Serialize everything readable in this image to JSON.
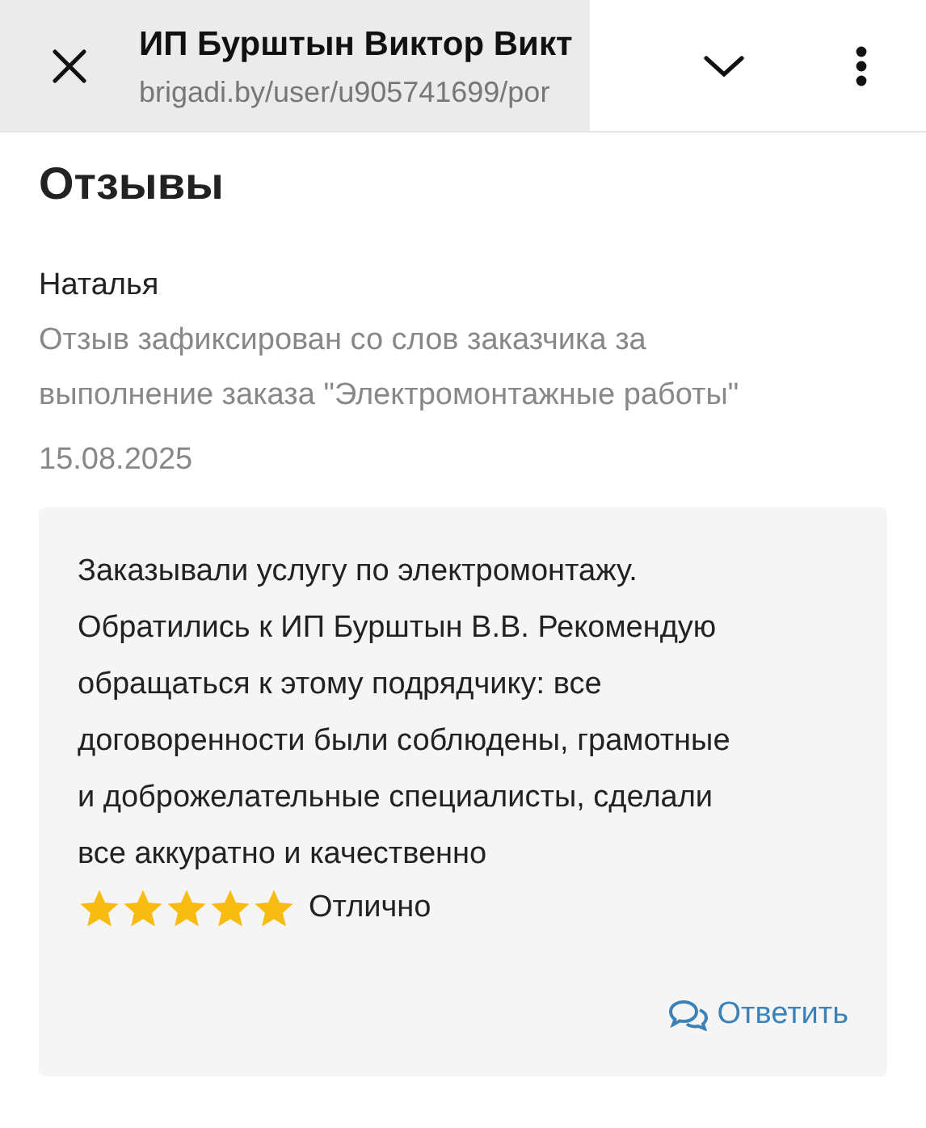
{
  "browser_bar": {
    "title": "ИП Бурштын Виктор Викт",
    "url": "brigadi.by/user/u905741699/por"
  },
  "section_title": "Отзывы",
  "reviews": [
    {
      "author": "Наталья",
      "note": "Отзыв зафиксирован со слов заказчика за выполнение заказа \"Электромонтажные работы\"",
      "date": "15.08.2025",
      "text": "Заказывали услугу по электромонтажу. Обратились к ИП Бурштын В.В. Рекомендую обращаться к этому подрядчику: все договоренности были соблюдены, грамотные и доброжелательные специалисты, сделали все аккуратно и качественно",
      "stars": 5,
      "rating_label": "Отлично",
      "reply": "Ответить"
    }
  ]
}
